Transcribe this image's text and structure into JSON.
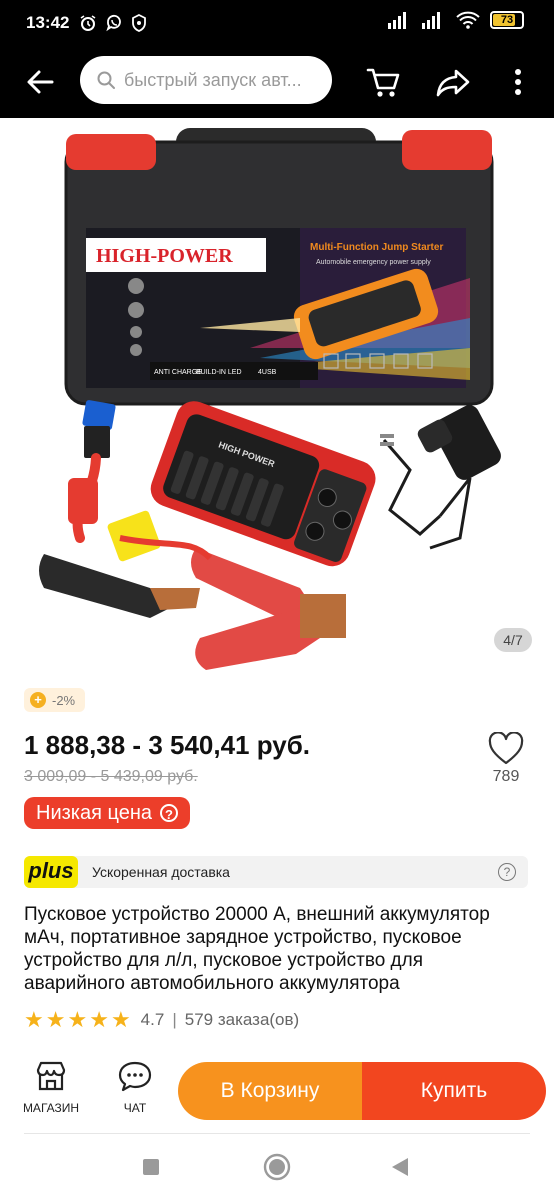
{
  "status_bar": {
    "time": "13:42",
    "battery_level": "73"
  },
  "search": {
    "placeholder": "быстрый запуск авт..."
  },
  "gallery": {
    "counter": "4/7"
  },
  "product": {
    "discount": "-2%",
    "price": "1 888,38 - 3 540,41 руб.",
    "old_price": "3 009,09 - 5 439,09 руб.",
    "likes": "789",
    "low_price_label": "Низкая цена",
    "plus_badge": "plus",
    "delivery_label": "Ускоренная доставка",
    "title": "Пусковое устройство 20000 А, внешний аккумулятор мАч, портативное зарядное устройство, пусковое устройство для л/л, пусковое устройство для аварийного автомобильного аккумулятора",
    "rating": "4.7",
    "orders": "579 заказа(ов)",
    "stars": 5
  },
  "bottom_bar": {
    "shop_label": "МАГАЗИН",
    "chat_label": "ЧАТ",
    "cart_label": "В Корзину",
    "buy_label": "Купить"
  },
  "photo_text": {
    "brand": "HIGH-POWER",
    "heading": "Multi-Function Jump Starter",
    "subheading": "Automobile emergency power supply",
    "feature_1": "ANTI CHARGE",
    "feature_2": "BUILD-IN LED",
    "feature_3": "4USB",
    "device_brand": "HIGH POWER"
  },
  "colors": {
    "accent_orange": "#f7921e",
    "accent_red": "#f2461f",
    "low_price_red": "#ec3e2a",
    "plus_yellow": "#f5e800",
    "star": "#f6b21a"
  }
}
